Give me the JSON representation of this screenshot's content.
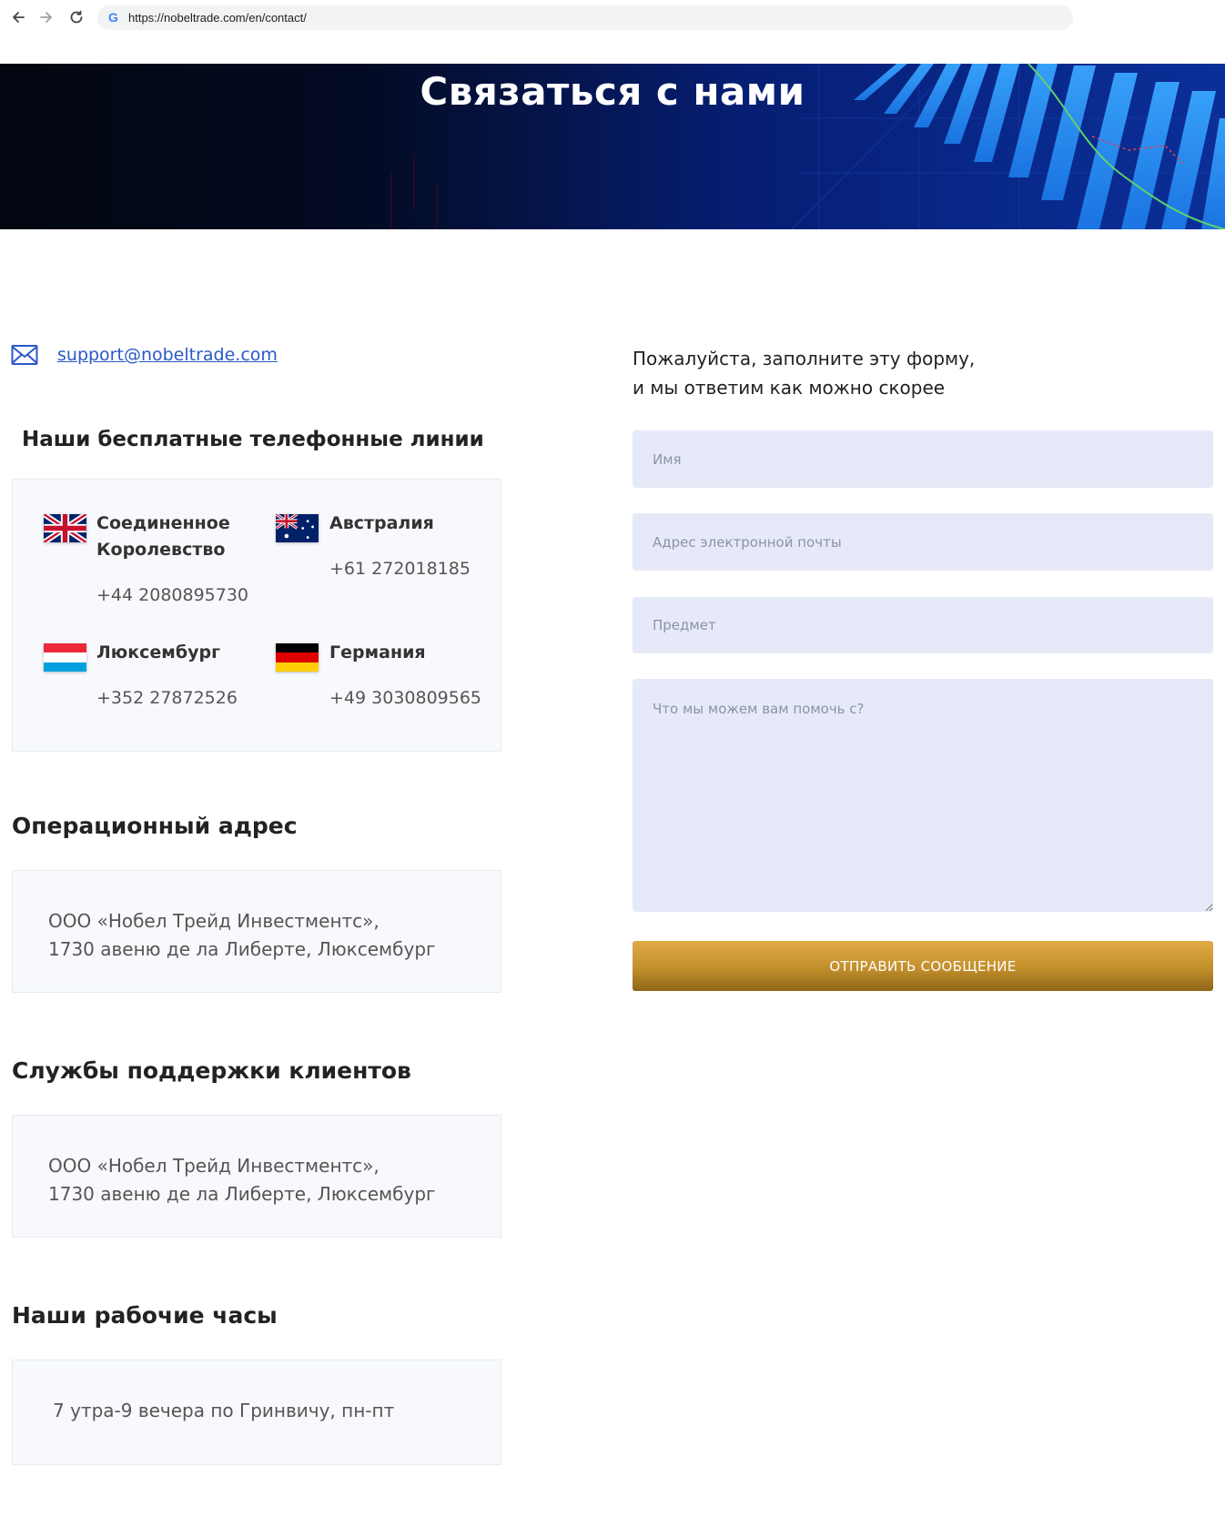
{
  "browser": {
    "url": "https://nobeltrade.com/en/contact/"
  },
  "hero": {
    "title": "Связаться с нами"
  },
  "contact": {
    "email": "support@nobeltrade.com"
  },
  "phones": {
    "title": "Наши бесплатные телефонные линии",
    "items": [
      {
        "country_line1": "Соединенное",
        "country_line2": "Королевство",
        "phone": "+44 2080895730",
        "flag": "uk-flag-icon"
      },
      {
        "country_line1": "Австралия",
        "phone": "+61 272018185",
        "flag": "australia-flag-icon"
      },
      {
        "country_line1": "Люксембург",
        "phone": "+352 27872526",
        "flag": "luxembourg-flag-icon"
      },
      {
        "country_line1": "Германия",
        "phone": "+49 3030809565",
        "flag": "germany-flag-icon"
      }
    ]
  },
  "operational_address": {
    "title": "Операционный адрес",
    "line1": "ООО «Нобел Трейд Инвестментс»,",
    "line2": "1730 авеню де ла Либерте, Люксембург"
  },
  "support_services": {
    "title": "Службы поддержки клиентов",
    "line1": "ООО «Нобел Трейд Инвестментс»,",
    "line2": "1730 авеню де ла Либерте, Люксембург"
  },
  "working_hours": {
    "title": "Наши рабочие часы",
    "text": "7 утра-9 вечера по Гринвичу, пн-пт"
  },
  "form": {
    "intro_line1": "Пожалуйста, заполните эту форму,",
    "intro_line2": "и мы ответим как можно скорее",
    "name_placeholder": "Имя",
    "email_placeholder": "Адрес электронной почты",
    "subject_placeholder": "Предмет",
    "message_placeholder": "Что мы можем вам помочь с?",
    "submit_label": "ОТПРАВИТЬ СООБЩЕНИЕ"
  },
  "colors": {
    "accent_gold": "#c28f2c",
    "link_blue": "#2a58c8",
    "field_bg": "#e6eaf8",
    "hero_blue": "#082788"
  }
}
